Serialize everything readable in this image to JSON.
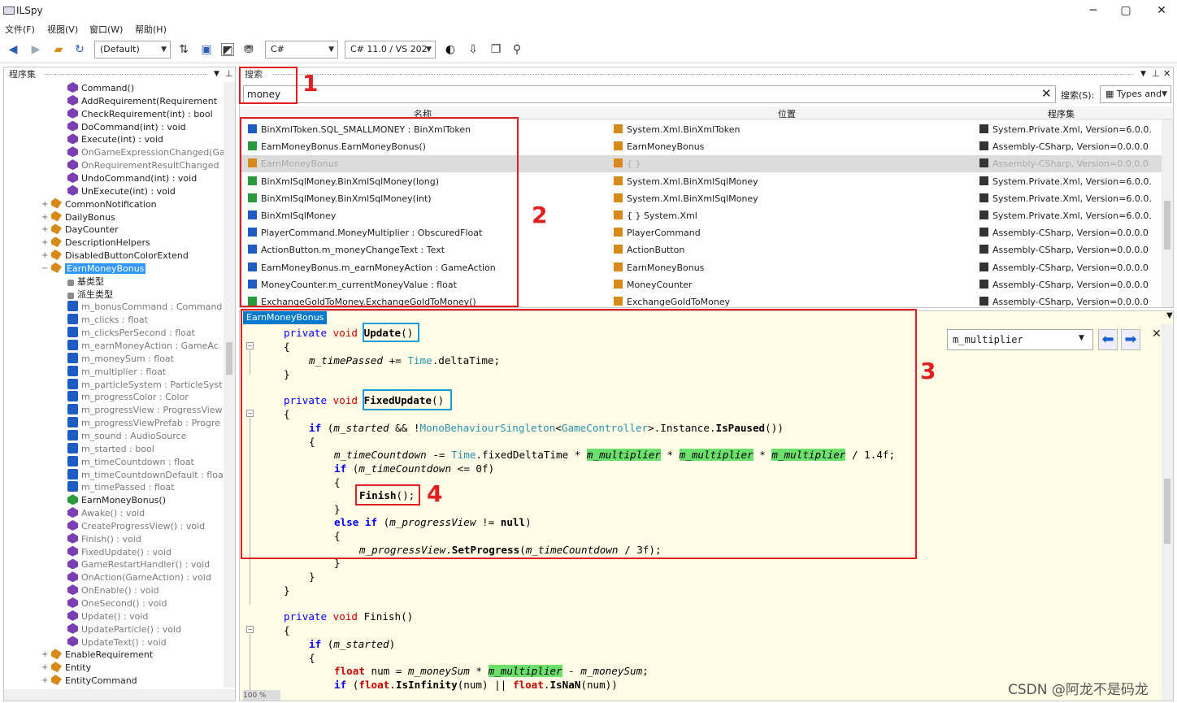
{
  "app": {
    "title": "ILSpy"
  },
  "window_controls": {
    "minimize": "─",
    "maximize": "▢",
    "close": "✕"
  },
  "menu": [
    "文件(F)",
    "视图(V)",
    "窗口(W)",
    "帮助(H)"
  ],
  "toolbar": {
    "assembly_list": "(Default)",
    "language": "C#",
    "version": "C# 11.0 / VS 202",
    "icons": [
      "back-icon",
      "forward-icon",
      "open-icon",
      "refresh-icon",
      "sort-icon",
      "collapse-icon",
      "show-all-icon",
      "search-icon"
    ]
  },
  "left_pane": {
    "header": "程序集",
    "items": [
      {
        "label": "Command()",
        "kind": "method",
        "indent": 1
      },
      {
        "label": "AddRequirement(Requirement",
        "kind": "method",
        "indent": 1
      },
      {
        "label": "CheckRequirement(int) : bool",
        "kind": "method",
        "indent": 1
      },
      {
        "label": "DoCommand(int) : void",
        "kind": "method",
        "indent": 1
      },
      {
        "label": "Execute(int) : void",
        "kind": "method",
        "indent": 1
      },
      {
        "label": "OnGameExpressionChanged(Ga",
        "kind": "method",
        "indent": 1,
        "grey": true
      },
      {
        "label": "OnRequirementResultChanged",
        "kind": "method",
        "indent": 1,
        "grey": true
      },
      {
        "label": "UndoCommand(int) : void",
        "kind": "method",
        "indent": 1
      },
      {
        "label": "UnExecute(int) : void",
        "kind": "method",
        "indent": 1
      },
      {
        "label": "CommonNotification",
        "kind": "class",
        "indent": 0
      },
      {
        "label": "DailyBonus",
        "kind": "class",
        "indent": 0
      },
      {
        "label": "DayCounter",
        "kind": "class",
        "indent": 0
      },
      {
        "label": "DescriptionHelpers",
        "kind": "class",
        "indent": 0
      },
      {
        "label": "DisabledButtonColorExtend",
        "kind": "class",
        "indent": 0
      },
      {
        "label": "EarnMoneyBonus",
        "kind": "class",
        "indent": 0,
        "selected": true
      },
      {
        "label": "基类型",
        "kind": "type",
        "indent": 1
      },
      {
        "label": "派生类型",
        "kind": "type",
        "indent": 1
      },
      {
        "label": "m_bonusCommand : Command",
        "kind": "field",
        "indent": 1,
        "grey": true
      },
      {
        "label": "m_clicks : float",
        "kind": "field",
        "indent": 1,
        "grey": true
      },
      {
        "label": "m_clicksPerSecond : float",
        "kind": "field",
        "indent": 1,
        "grey": true
      },
      {
        "label": "m_earnMoneyAction : GameAc",
        "kind": "field",
        "indent": 1,
        "grey": true
      },
      {
        "label": "m_moneySum : float",
        "kind": "field",
        "indent": 1,
        "grey": true
      },
      {
        "label": "m_multiplier : float",
        "kind": "field",
        "indent": 1,
        "grey": true
      },
      {
        "label": "m_particleSystem : ParticleSyst",
        "kind": "field",
        "indent": 1,
        "grey": true
      },
      {
        "label": "m_progressColor : Color",
        "kind": "field",
        "indent": 1,
        "grey": true
      },
      {
        "label": "m_progressView : ProgressView",
        "kind": "field",
        "indent": 1,
        "grey": true
      },
      {
        "label": "m_progressViewPrefab : Progre",
        "kind": "field",
        "indent": 1,
        "grey": true
      },
      {
        "label": "m_sound : AudioSource",
        "kind": "field",
        "indent": 1,
        "grey": true
      },
      {
        "label": "m_started : bool",
        "kind": "field",
        "indent": 1,
        "grey": true
      },
      {
        "label": "m_timeCountdown : float",
        "kind": "field",
        "indent": 1,
        "grey": true
      },
      {
        "label": "m_timeCountdownDefault : floa",
        "kind": "field",
        "indent": 1,
        "grey": true
      },
      {
        "label": "m_timePassed : float",
        "kind": "field",
        "indent": 1,
        "grey": true
      },
      {
        "label": "EarnMoneyBonus()",
        "kind": "ctor",
        "indent": 1
      },
      {
        "label": "Awake() : void",
        "kind": "method",
        "indent": 1,
        "grey": true
      },
      {
        "label": "CreateProgressView() : void",
        "kind": "method",
        "indent": 1,
        "grey": true
      },
      {
        "label": "Finish() : void",
        "kind": "method",
        "indent": 1,
        "grey": true
      },
      {
        "label": "FixedUpdate() : void",
        "kind": "method",
        "indent": 1,
        "grey": true
      },
      {
        "label": "GameRestartHandler() : void",
        "kind": "method",
        "indent": 1,
        "grey": true
      },
      {
        "label": "OnAction(GameAction) : void",
        "kind": "method",
        "indent": 1,
        "grey": true
      },
      {
        "label": "OnEnable() : void",
        "kind": "method",
        "indent": 1,
        "grey": true
      },
      {
        "label": "OneSecond() : void",
        "kind": "method",
        "indent": 1,
        "grey": true
      },
      {
        "label": "Update() : void",
        "kind": "method",
        "indent": 1,
        "grey": true
      },
      {
        "label": "UpdateParticle() : void",
        "kind": "method",
        "indent": 1,
        "grey": true
      },
      {
        "label": "UpdateText() : void",
        "kind": "method",
        "indent": 1,
        "grey": true
      },
      {
        "label": "EnableRequirement",
        "kind": "class",
        "indent": 0
      },
      {
        "label": "Entity",
        "kind": "class",
        "indent": 0
      },
      {
        "label": "EntityCommand",
        "kind": "class",
        "indent": 0
      }
    ]
  },
  "search_pane": {
    "header": "搜索",
    "query": "money",
    "search_label": "搜索(S):",
    "mode": "Types and",
    "columns": [
      "名称",
      "位置",
      "程序集"
    ],
    "rows": [
      {
        "name": "BinXmlToken.SQL_SMALLMONEY : BinXmlToken",
        "location": "System.Xml.BinXmlToken",
        "assembly": "System.Private.Xml, Version=6.0.0."
      },
      {
        "name": "EarnMoneyBonus.EarnMoneyBonus()",
        "location": "EarnMoneyBonus",
        "assembly": "Assembly-CSharp, Version=0.0.0.0"
      },
      {
        "name": "EarnMoneyBonus",
        "location": "{ }",
        "assembly": "Assembly-CSharp, Version=0.0.0.0",
        "highlight": true
      },
      {
        "name": "BinXmlSqlMoney.BinXmlSqlMoney(long)",
        "location": "System.Xml.BinXmlSqlMoney",
        "assembly": "System.Private.Xml, Version=6.0.0."
      },
      {
        "name": "BinXmlSqlMoney.BinXmlSqlMoney(int)",
        "location": "System.Xml.BinXmlSqlMoney",
        "assembly": "System.Private.Xml, Version=6.0.0."
      },
      {
        "name": "BinXmlSqlMoney",
        "location": "{ } System.Xml",
        "assembly": "System.Private.Xml, Version=6.0.0."
      },
      {
        "name": "PlayerCommand.MoneyMultiplier : ObscuredFloat",
        "location": "PlayerCommand",
        "assembly": "Assembly-CSharp, Version=0.0.0.0"
      },
      {
        "name": "ActionButton.m_moneyChangeText : Text",
        "location": "ActionButton",
        "assembly": "Assembly-CSharp, Version=0.0.0.0"
      },
      {
        "name": "EarnMoneyBonus.m_earnMoneyAction : GameAction",
        "location": "EarnMoneyBonus",
        "assembly": "Assembly-CSharp, Version=0.0.0.0"
      },
      {
        "name": "MoneyCounter.m_currentMoneyValue : float",
        "location": "MoneyCounter",
        "assembly": "Assembly-CSharp, Version=0.0.0.0"
      },
      {
        "name": "ExchangeGoldToMoney.ExchangeGoldToMoney()",
        "location": "ExchangeGoldToMoney",
        "assembly": "Assembly-CSharp, Version=0.0.0.0"
      }
    ]
  },
  "code_pane": {
    "tab": "EarnMoneyBonus",
    "find_value": "m_multiplier",
    "zoom": "100 %"
  },
  "annotations": [
    "1",
    "2",
    "3",
    "4"
  ],
  "watermark": "CSDN @阿龙不是码龙",
  "colors": {
    "accent": "#3399ff",
    "annotation_red": "#e02020",
    "annotation_blue": "#1a9ad6",
    "highlight_green": "#6be06b",
    "code_bg": "#fffde6"
  }
}
